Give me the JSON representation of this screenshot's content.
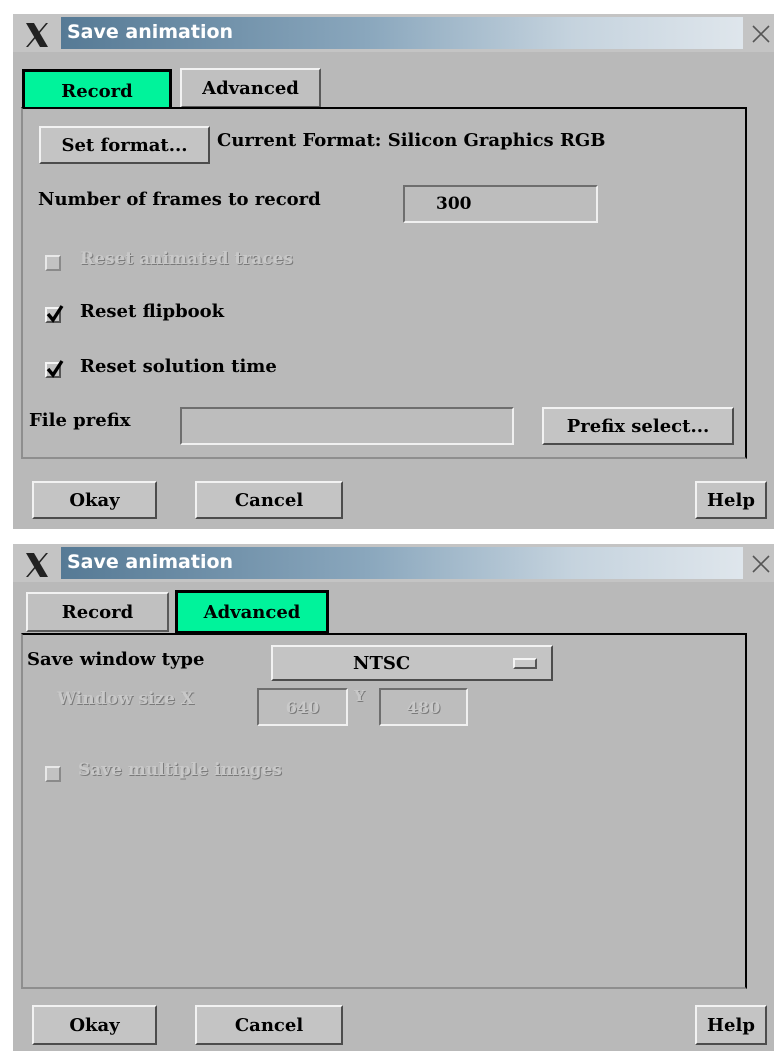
{
  "dialog1": {
    "title": "Save animation",
    "tabs": [
      {
        "label": "Record",
        "active": true
      },
      {
        "label": "Advanced",
        "active": false
      }
    ],
    "set_format_button": "Set format...",
    "current_format_text": "Current Format: Silicon Graphics RGB",
    "frames_label": "Number of frames to record",
    "frames_value": "300",
    "reset_animated_traces": {
      "label": "Reset animated traces",
      "checked": false,
      "enabled": false
    },
    "reset_flipbook": {
      "label": "Reset flipbook",
      "checked": true,
      "enabled": true
    },
    "reset_solution_time": {
      "label": "Reset solution time",
      "checked": true,
      "enabled": true
    },
    "file_prefix_label": "File prefix",
    "file_prefix_value": "",
    "prefix_select_button": "Prefix select...",
    "okay_button": "Okay",
    "cancel_button": "Cancel",
    "help_button": "Help"
  },
  "dialog2": {
    "title": "Save animation",
    "tabs": [
      {
        "label": "Record",
        "active": false
      },
      {
        "label": "Advanced",
        "active": true
      }
    ],
    "save_window_type_label": "Save window type",
    "save_window_type_value": "NTSC",
    "window_size_label": "Window size X",
    "window_size_x": "640",
    "window_size_y_label": "Y",
    "window_size_y": "480",
    "save_multiple_images": {
      "label": "Save multiple images",
      "checked": false,
      "enabled": false
    },
    "okay_button": "Okay",
    "cancel_button": "Cancel",
    "help_button": "Help"
  },
  "colors": {
    "active_tab": "#00f39b",
    "dialog_bg": "#b9b9b9",
    "title_gradient_start": "#567a95"
  }
}
